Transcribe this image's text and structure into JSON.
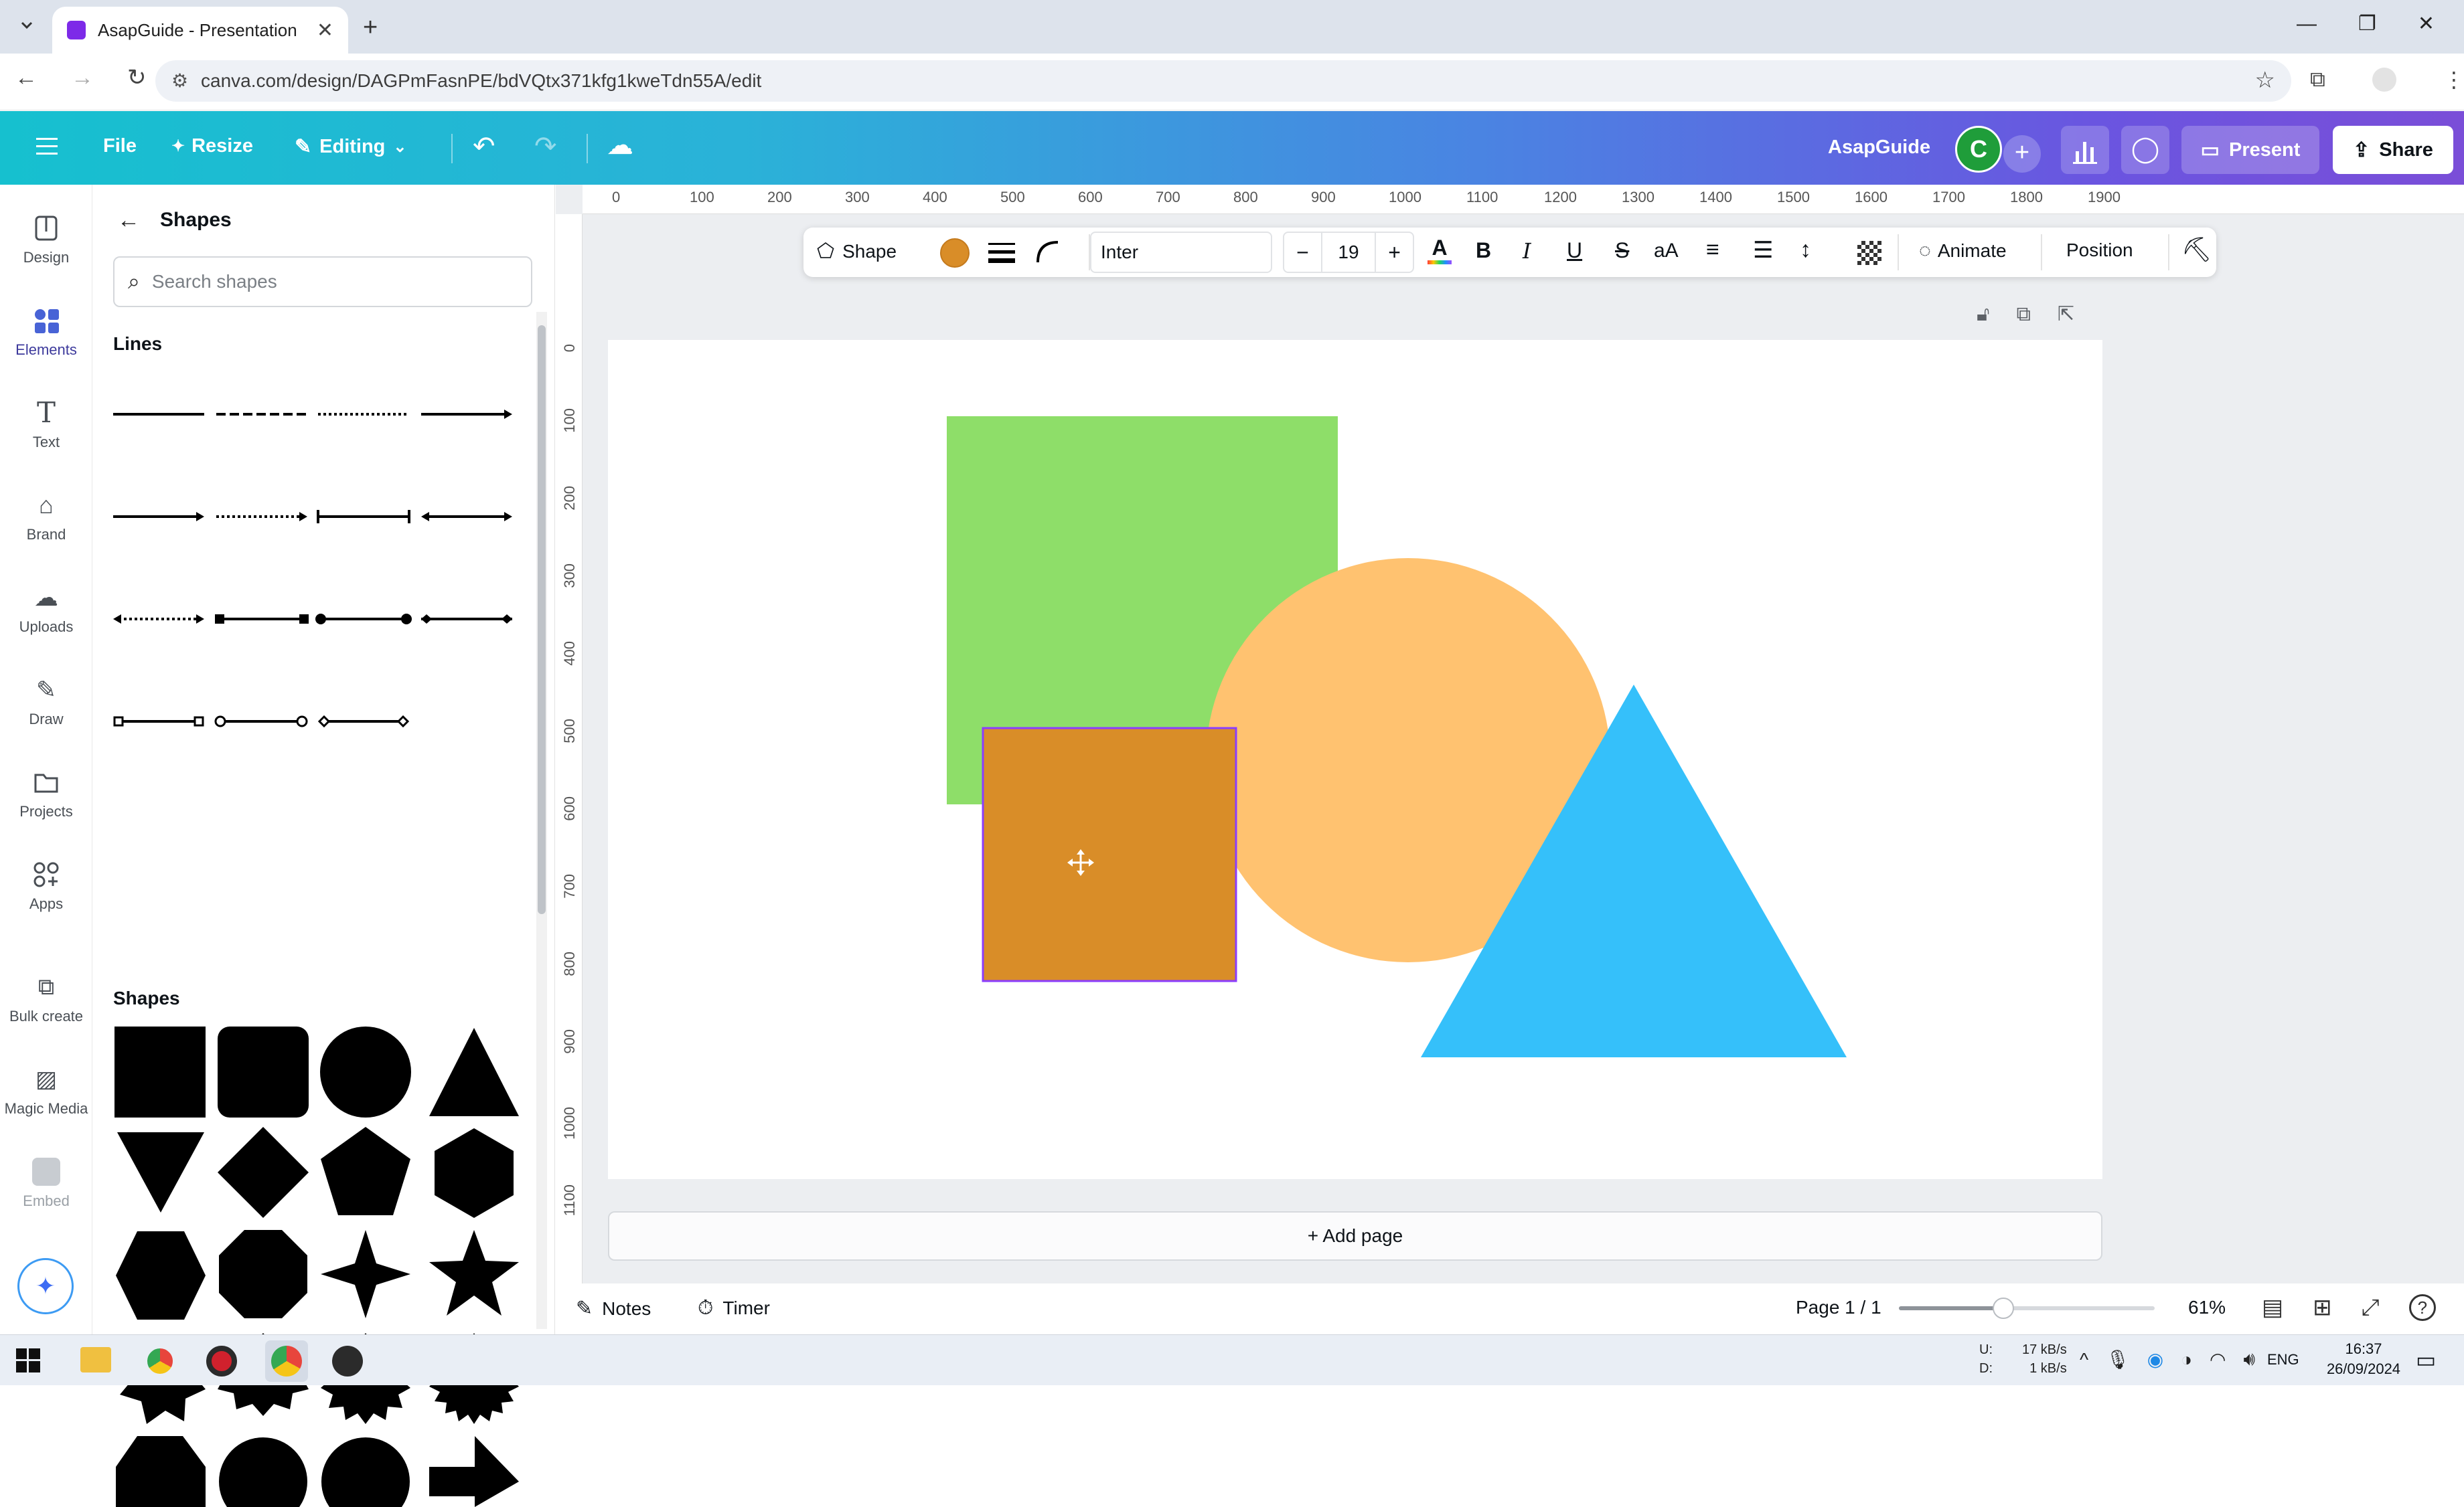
{
  "browser": {
    "tab_title": "AsapGuide - Presentation",
    "url": "canva.com/design/DAGPmFasnPE/bdVQtx371kfg1kweTdn55A/edit"
  },
  "header": {
    "file": "File",
    "resize": "Resize",
    "editing": "Editing",
    "team_name": "AsapGuide",
    "avatar_letter": "C",
    "present": "Present",
    "share": "Share"
  },
  "rail": {
    "items": [
      {
        "label": "Design",
        "icon": "design-icon"
      },
      {
        "label": "Elements",
        "icon": "elements-icon"
      },
      {
        "label": "Text",
        "icon": "text-icon"
      },
      {
        "label": "Brand",
        "icon": "brand-icon"
      },
      {
        "label": "Uploads",
        "icon": "uploads-icon"
      },
      {
        "label": "Draw",
        "icon": "draw-icon"
      },
      {
        "label": "Projects",
        "icon": "projects-icon"
      },
      {
        "label": "Apps",
        "icon": "apps-icon"
      },
      {
        "label": "Bulk create",
        "icon": "bulk-create-icon"
      },
      {
        "label": "Magic Media",
        "icon": "magic-media-icon"
      },
      {
        "label": "Embed",
        "icon": "embed-icon"
      }
    ]
  },
  "panel": {
    "title": "Shapes",
    "search_placeholder": "Search shapes",
    "lines_heading": "Lines",
    "shapes_heading": "Shapes"
  },
  "ruler": {
    "top": [
      "0",
      "100",
      "200",
      "300",
      "400",
      "500",
      "600",
      "700",
      "800",
      "900",
      "1000",
      "1100",
      "1200",
      "1300",
      "1400",
      "1500",
      "1600",
      "1700",
      "1800",
      "1900"
    ],
    "left": [
      "0",
      "100",
      "200",
      "300",
      "400",
      "500",
      "600",
      "700",
      "800",
      "900",
      "1000",
      "1100"
    ]
  },
  "toolbar": {
    "shape": "Shape",
    "font": "Inter",
    "font_size": "19",
    "minus": "−",
    "plus": "+",
    "animate": "Animate",
    "position": "Position",
    "color": "#d98d28"
  },
  "canvas": {
    "add_page": "+ Add page",
    "colors": {
      "green": "#8ede69",
      "orange_circle": "#ffc270",
      "orange_square": "#d98d28",
      "blue_triangle": "#35c0fa",
      "selection": "#8b3dff"
    }
  },
  "bottom": {
    "notes": "Notes",
    "timer": "Timer",
    "page_indicator": "Page 1 / 1",
    "zoom": "61%",
    "zoom_level": 0.61
  },
  "taskbar": {
    "net_up_label": "U:",
    "net_down_label": "D:",
    "net_up": "17 kB/s",
    "net_down": "1 kB/s",
    "lang": "ENG",
    "time": "16:37",
    "date": "26/09/2024"
  }
}
